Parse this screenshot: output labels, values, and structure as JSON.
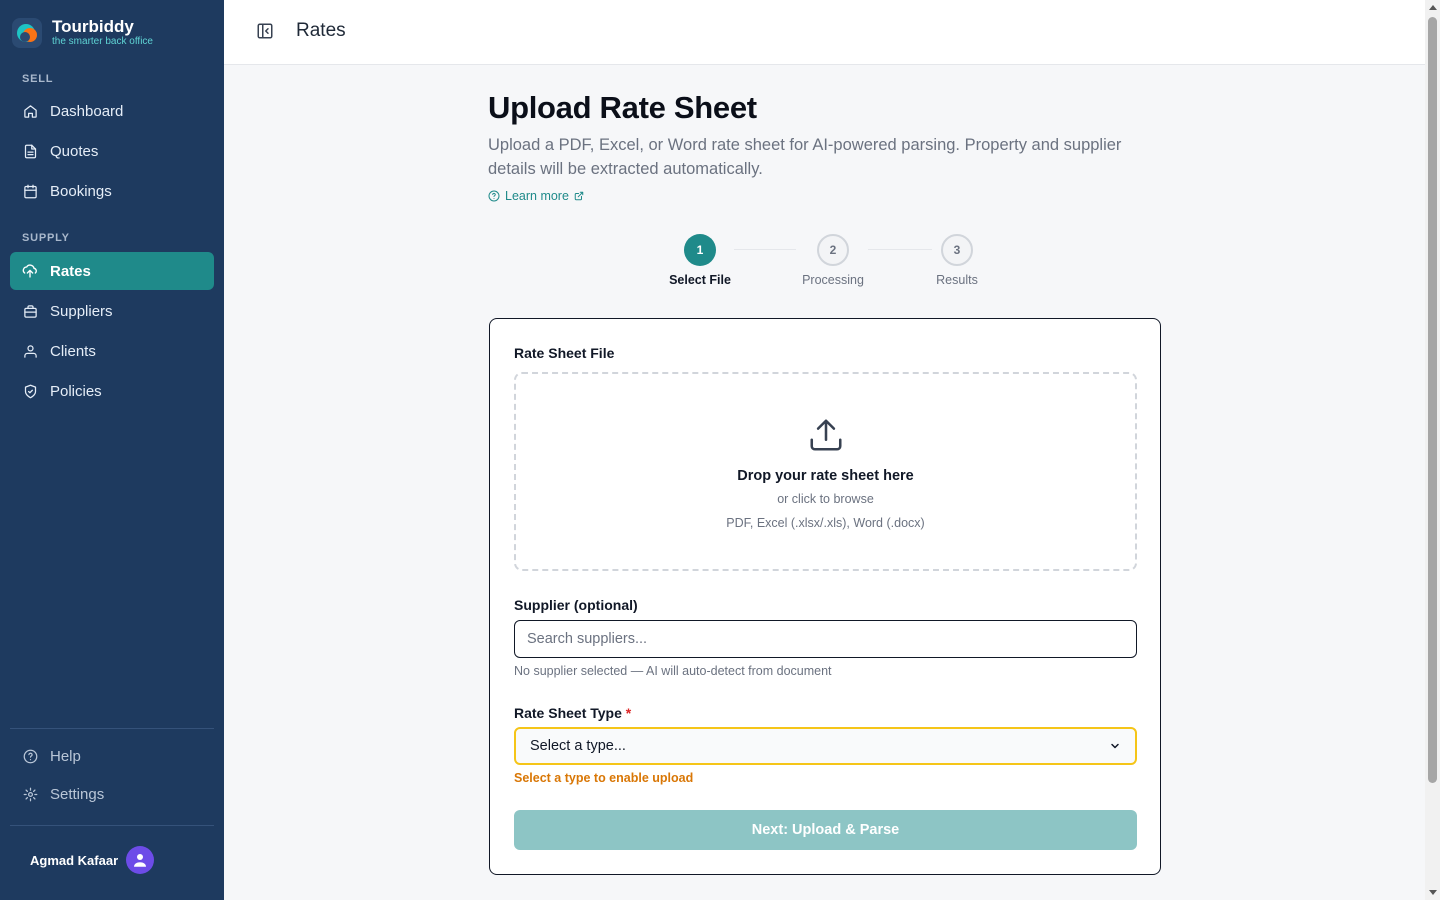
{
  "brand": {
    "name": "Tourbiddy",
    "tagline": "the smarter back office"
  },
  "sidebar": {
    "sections": [
      {
        "label": "SELL",
        "items": [
          {
            "label": "Dashboard",
            "icon": "home-icon"
          },
          {
            "label": "Quotes",
            "icon": "document-icon"
          },
          {
            "label": "Bookings",
            "icon": "calendar-icon"
          }
        ]
      },
      {
        "label": "SUPPLY",
        "items": [
          {
            "label": "Rates",
            "icon": "cloud-upload-icon",
            "active": true
          },
          {
            "label": "Suppliers",
            "icon": "briefcase-icon"
          },
          {
            "label": "Clients",
            "icon": "users-icon"
          },
          {
            "label": "Policies",
            "icon": "shield-icon"
          }
        ]
      }
    ],
    "footer_items": [
      {
        "label": "Help",
        "icon": "help-circle-icon"
      },
      {
        "label": "Settings",
        "icon": "gear-icon"
      }
    ],
    "user": {
      "name": "Agmad Kafaar"
    }
  },
  "topbar": {
    "title": "Rates"
  },
  "page": {
    "title": "Upload Rate Sheet",
    "description": "Upload a PDF, Excel, or Word rate sheet for AI-powered parsing. Property and supplier details will be extracted automatically.",
    "learn_more": "Learn more"
  },
  "stepper": [
    {
      "number": "1",
      "label": "Select File",
      "state": "active"
    },
    {
      "number": "2",
      "label": "Processing",
      "state": "pending"
    },
    {
      "number": "3",
      "label": "Results",
      "state": "pending"
    }
  ],
  "form": {
    "file_label": "Rate Sheet File",
    "dropzone": {
      "title": "Drop your rate sheet here",
      "subtitle": "or click to browse",
      "types": "PDF, Excel (.xlsx/.xls), Word (.docx)"
    },
    "supplier_label": "Supplier (optional)",
    "supplier_placeholder": "Search suppliers...",
    "supplier_value": "",
    "supplier_hint": "No supplier selected — AI will auto-detect from document",
    "type_label": "Rate Sheet Type",
    "type_required_mark": "*",
    "type_selected": "Select a type...",
    "type_warning": "Select a type to enable upload",
    "submit_label": "Next: Upload & Parse"
  },
  "colors": {
    "sidebar_bg": "#1e3a5f",
    "accent": "#1f8a8a",
    "warning": "#d97706",
    "select_focus": "#f5c518"
  }
}
